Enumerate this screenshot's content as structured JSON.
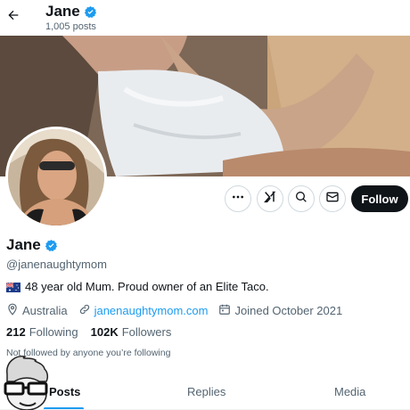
{
  "header": {
    "back_icon": "arrow-left-icon",
    "name": "Jane",
    "posts_count": "1,005 posts",
    "verified_icon": "verified-badge-icon"
  },
  "colors": {
    "accent": "#1d9bf0",
    "text_primary": "#0f1419",
    "text_secondary": "#536471",
    "follow_button_bg": "#0f1419"
  },
  "actions": {
    "more_icon": "more-icon",
    "grok_icon": "grok-icon",
    "search_icon": "search-icon",
    "message_icon": "mail-icon",
    "follow_label": "Follow"
  },
  "profile": {
    "name": "Jane",
    "handle": "@janenaughtymom",
    "bio": "48 year old Mum. Proud owner of an Elite Taco.",
    "bio_flag_icon": "australia-flag-icon",
    "location": "Australia",
    "website": "janenaughtymom.com",
    "joined": "Joined October 2021",
    "following_count": "212",
    "following_label": "Following",
    "followers_count": "102K",
    "followers_label": "Followers",
    "not_followed": "Not followed by anyone you’re following"
  },
  "tabs": [
    {
      "label": "Posts",
      "active": true
    },
    {
      "label": "Replies",
      "active": false
    },
    {
      "label": "Media",
      "active": false
    }
  ]
}
